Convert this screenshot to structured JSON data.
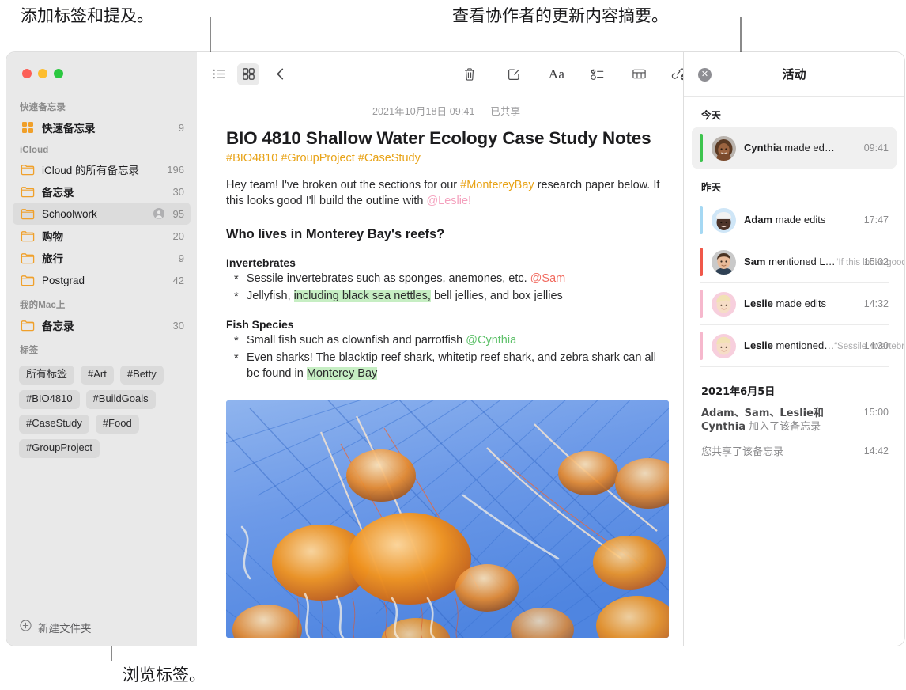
{
  "callouts": {
    "tags": "添加标签和提及。",
    "activity": "查看协作者的更新内容摘要。",
    "browse": "浏览标签。"
  },
  "window_controls": {
    "close": "close-button",
    "minimize": "minimize-button",
    "zoom": "zoom-button"
  },
  "sidebar": {
    "groups": [
      {
        "title": "快速备忘录",
        "rows": [
          {
            "icon": "quick-note-icon",
            "label": "快速备忘录",
            "count": "9",
            "bold": true,
            "selected": false,
            "shared": false
          }
        ]
      },
      {
        "title": "iCloud",
        "rows": [
          {
            "icon": "folder-icon",
            "label": "iCloud 的所有备忘录",
            "count": "196",
            "bold": false,
            "selected": false,
            "shared": false
          },
          {
            "icon": "folder-icon",
            "label": "备忘录",
            "count": "30",
            "bold": true,
            "selected": false,
            "shared": false
          },
          {
            "icon": "folder-icon",
            "label": "Schoolwork",
            "count": "95",
            "bold": false,
            "selected": true,
            "shared": true
          },
          {
            "icon": "folder-icon",
            "label": "购物",
            "count": "20",
            "bold": true,
            "selected": false,
            "shared": false
          },
          {
            "icon": "folder-icon",
            "label": "旅行",
            "count": "9",
            "bold": true,
            "selected": false,
            "shared": false
          },
          {
            "icon": "folder-icon",
            "label": "Postgrad",
            "count": "42",
            "bold": false,
            "selected": false,
            "shared": false
          }
        ]
      },
      {
        "title": "我的Mac上",
        "rows": [
          {
            "icon": "folder-icon",
            "label": "备忘录",
            "count": "30",
            "bold": true,
            "selected": false,
            "shared": false
          }
        ]
      }
    ],
    "tags_title": "标签",
    "tags": [
      "所有标签",
      "#Art",
      "#Betty",
      "#BIO4810",
      "#BuildGoals",
      "#CaseStudy",
      "#Food",
      "#GroupProject"
    ],
    "new_folder": "新建文件夹"
  },
  "toolbar": {
    "list_view": "list-view-icon",
    "gallery_view": "gallery-view-icon",
    "back": "back-chevron-icon",
    "delete": "trash-icon",
    "compose": "compose-icon",
    "format": "Aa",
    "checklist": "checklist-icon",
    "table": "table-icon",
    "link": "add-link-icon",
    "lock": "lock-icon",
    "media": "media-icon",
    "collaborate": "collaborate-icon",
    "share": "share-icon",
    "search": "search-icon"
  },
  "note": {
    "date": "2021年10月18日 09:41 — 已共享",
    "title": "BIO 4810 Shallow Water Ecology Case Study Notes",
    "hashtags": "#BIO4810 #GroupProject #CaseStudy",
    "intro": {
      "part1": "Hey team! I've broken out the sections for our ",
      "tag": "#MontereyBay",
      "part2": " research paper below. If this looks good I'll build the outline with ",
      "mention": "@Leslie!"
    },
    "section_heading": "Who lives in Monterey Bay's reefs?",
    "groups": [
      {
        "heading": "Invertebrates",
        "items": [
          {
            "pre": "Sessile invertebrates such as sponges, anemones, etc. ",
            "mention": "@Sam",
            "mention_color": "mention-r",
            "post": "",
            "highlight": "",
            "tail": ""
          },
          {
            "pre": "Jellyfish, ",
            "mention": "",
            "mention_color": "",
            "post": "",
            "highlight": "including black sea nettles,",
            "tail": " bell jellies, and box jellies"
          }
        ]
      },
      {
        "heading": "Fish Species",
        "items": [
          {
            "pre": "Small fish such as clownfish and parrotfish ",
            "mention": "@Cynthia",
            "mention_color": "mention-g",
            "post": "",
            "highlight": "",
            "tail": ""
          },
          {
            "pre": "Even sharks! The blacktip reef shark, whitetip reef shark, and zebra shark can all be found in ",
            "mention": "",
            "mention_color": "",
            "post": "",
            "highlight": "Monterey Bay",
            "tail": ""
          }
        ]
      }
    ],
    "photo_alt": "jellyfish-photo"
  },
  "activity": {
    "title": "活动",
    "close": "close-icon",
    "sections": [
      {
        "label": "今天",
        "items": [
          {
            "name": "Cynthia",
            "action": " made ed…",
            "quote": "",
            "time": "09:41",
            "bar": "#3dc44e",
            "selected": true,
            "avatar": "avatar-cynthia"
          }
        ]
      },
      {
        "label": "昨天",
        "items": [
          {
            "name": "Adam",
            "action": " made edits",
            "quote": "",
            "time": "17:47",
            "bar": "#a5d8f3",
            "selected": false,
            "avatar": "avatar-adam"
          },
          {
            "name": "Sam",
            "action": " mentioned L…",
            "quote": "“If this looks good I'll…",
            "time": "15:02",
            "bar": "#f0584a",
            "selected": false,
            "avatar": "avatar-sam"
          },
          {
            "name": "Leslie",
            "action": " made edits",
            "quote": "",
            "time": "14:32",
            "bar": "#f6b8cd",
            "selected": false,
            "avatar": "avatar-leslie"
          },
          {
            "name": "Leslie",
            "action": " mentioned…",
            "quote": "“Sessile invertebrates…",
            "time": "14:30",
            "bar": "#f6b8cd",
            "selected": false,
            "avatar": "avatar-leslie"
          }
        ]
      }
    ],
    "date_group": {
      "label": "2021年6月5日",
      "entries": [
        {
          "bold": "Adam、Sam、Leslie和 Cynthia",
          "rest": " 加入了该备忘录",
          "time": "15:00"
        },
        {
          "bold": "",
          "rest": "您共享了该备忘录",
          "time": "14:42"
        }
      ]
    }
  },
  "colors": {
    "accent_yellow": "#e8a317",
    "folder_orange": "#f0a02a",
    "highlight_green": "#c6eec3",
    "sidebar_bg": "#e9e9e9",
    "selection_bg": "#dcdcdc"
  }
}
